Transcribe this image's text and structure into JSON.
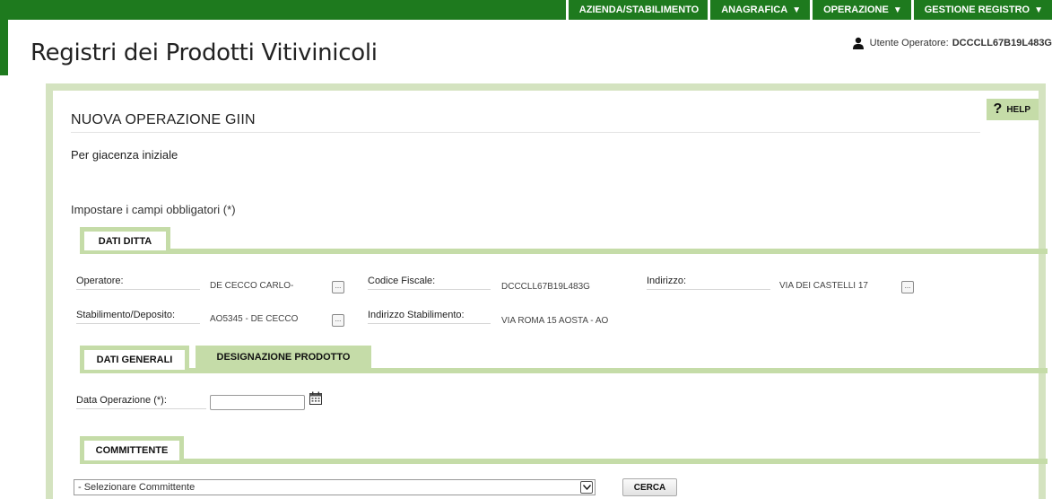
{
  "nav": {
    "items": [
      {
        "label": "AZIENDA/STABILIMENTO",
        "caret": ""
      },
      {
        "label": "ANAGRAFICA",
        "caret": "▼"
      },
      {
        "label": "OPERAZIONE",
        "caret": "▼"
      },
      {
        "label": "GESTIONE REGISTRO",
        "caret": "▼"
      }
    ]
  },
  "header": {
    "app_title": "Registri dei Prodotti Vitivinicoli",
    "user_label": "Utente Operatore:",
    "user_id": "DCCCLL67B19L483G"
  },
  "panel": {
    "help_label": "HELP",
    "help_glyph": "?",
    "title": "NUOVA OPERAZIONE GIIN",
    "subtitle": "Per giacenza iniziale",
    "required_note": "Impostare i campi obbligatori (*)"
  },
  "dati_ditta": {
    "tab_label": "DATI DITTA",
    "operatore_label": "Operatore:",
    "operatore_value": "DE CECCO CARLO-",
    "codice_fiscale_label": "Codice Fiscale:",
    "codice_fiscale_value": "DCCCLL67B19L483G",
    "indirizzo_label": "Indirizzo:",
    "indirizzo_value": "VIA DEI CASTELLI 17",
    "stabilimento_label": "Stabilimento/Deposito:",
    "stabilimento_value": "AO5345 - DE CECCO",
    "indirizzo_stab_label": "Indirizzo Stabilimento:",
    "indirizzo_stab_value": "VIA ROMA 15 AOSTA -  AO",
    "dots": "..."
  },
  "tabs2": {
    "dati_generali": "DATI GENERALI",
    "designazione": "DESIGNAZIONE PRODOTTO"
  },
  "dati_generali": {
    "data_operazione_label": "Data Operazione (*):",
    "data_operazione_value": ""
  },
  "committente": {
    "tab_label": "COMMITTENTE",
    "select_value": "- Selezionare Committente",
    "cerca_label": "CERCA"
  },
  "colors": {
    "top_bar": "#1e7a1e",
    "panel_border": "#d4e3c0",
    "tab_green": "#c5dca8"
  }
}
